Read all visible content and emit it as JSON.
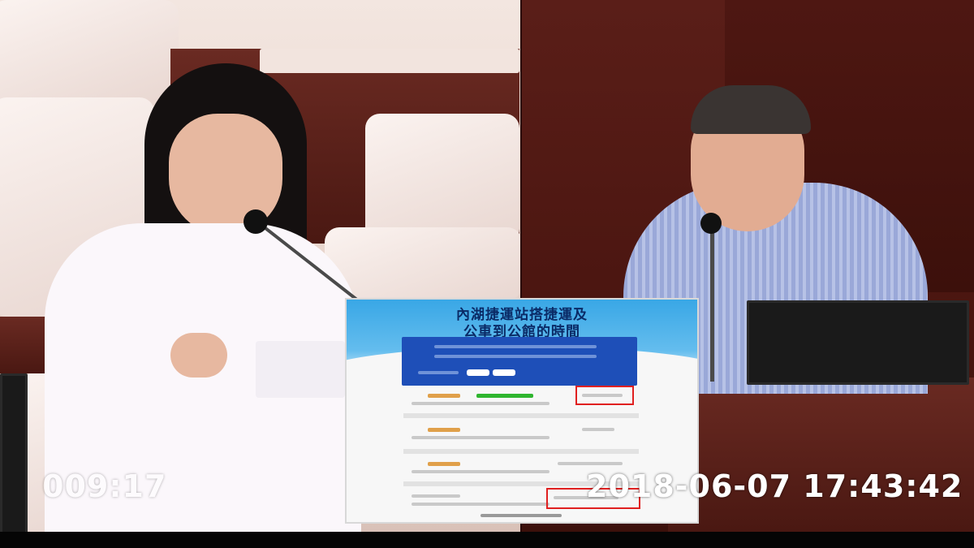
{
  "slide": {
    "title_line1": "內湖捷運站搭捷運及",
    "title_line2": "公車到公館的時間"
  },
  "overlay": {
    "counter": "009:17",
    "timestamp": "2018-06-07 17:43:42"
  }
}
